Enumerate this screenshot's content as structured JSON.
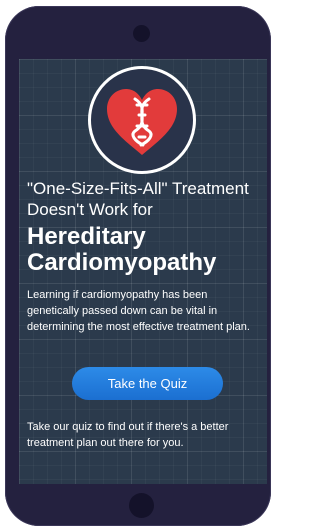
{
  "hero": {
    "icon": "heart-dna-icon",
    "colors": {
      "heart": "#e23b3b",
      "dna": "#ffffff"
    }
  },
  "headline": {
    "line1": "\"One-Size-Fits-All\" Treatment Doesn't Work for",
    "line2": "Hereditary Cardiomyopathy"
  },
  "body": {
    "text": "Learning if cardiomyopathy has been genetically passed down can be vital in determining the most effective treatment plan."
  },
  "cta": {
    "label": "Take the Quiz",
    "color": "#1f7ae0"
  },
  "footer": {
    "text": "Take our quiz to find out if there's a better treatment plan out there for you."
  },
  "theme": {
    "phone_frame": "#24213f",
    "screen_background": "#2b3a4c"
  }
}
